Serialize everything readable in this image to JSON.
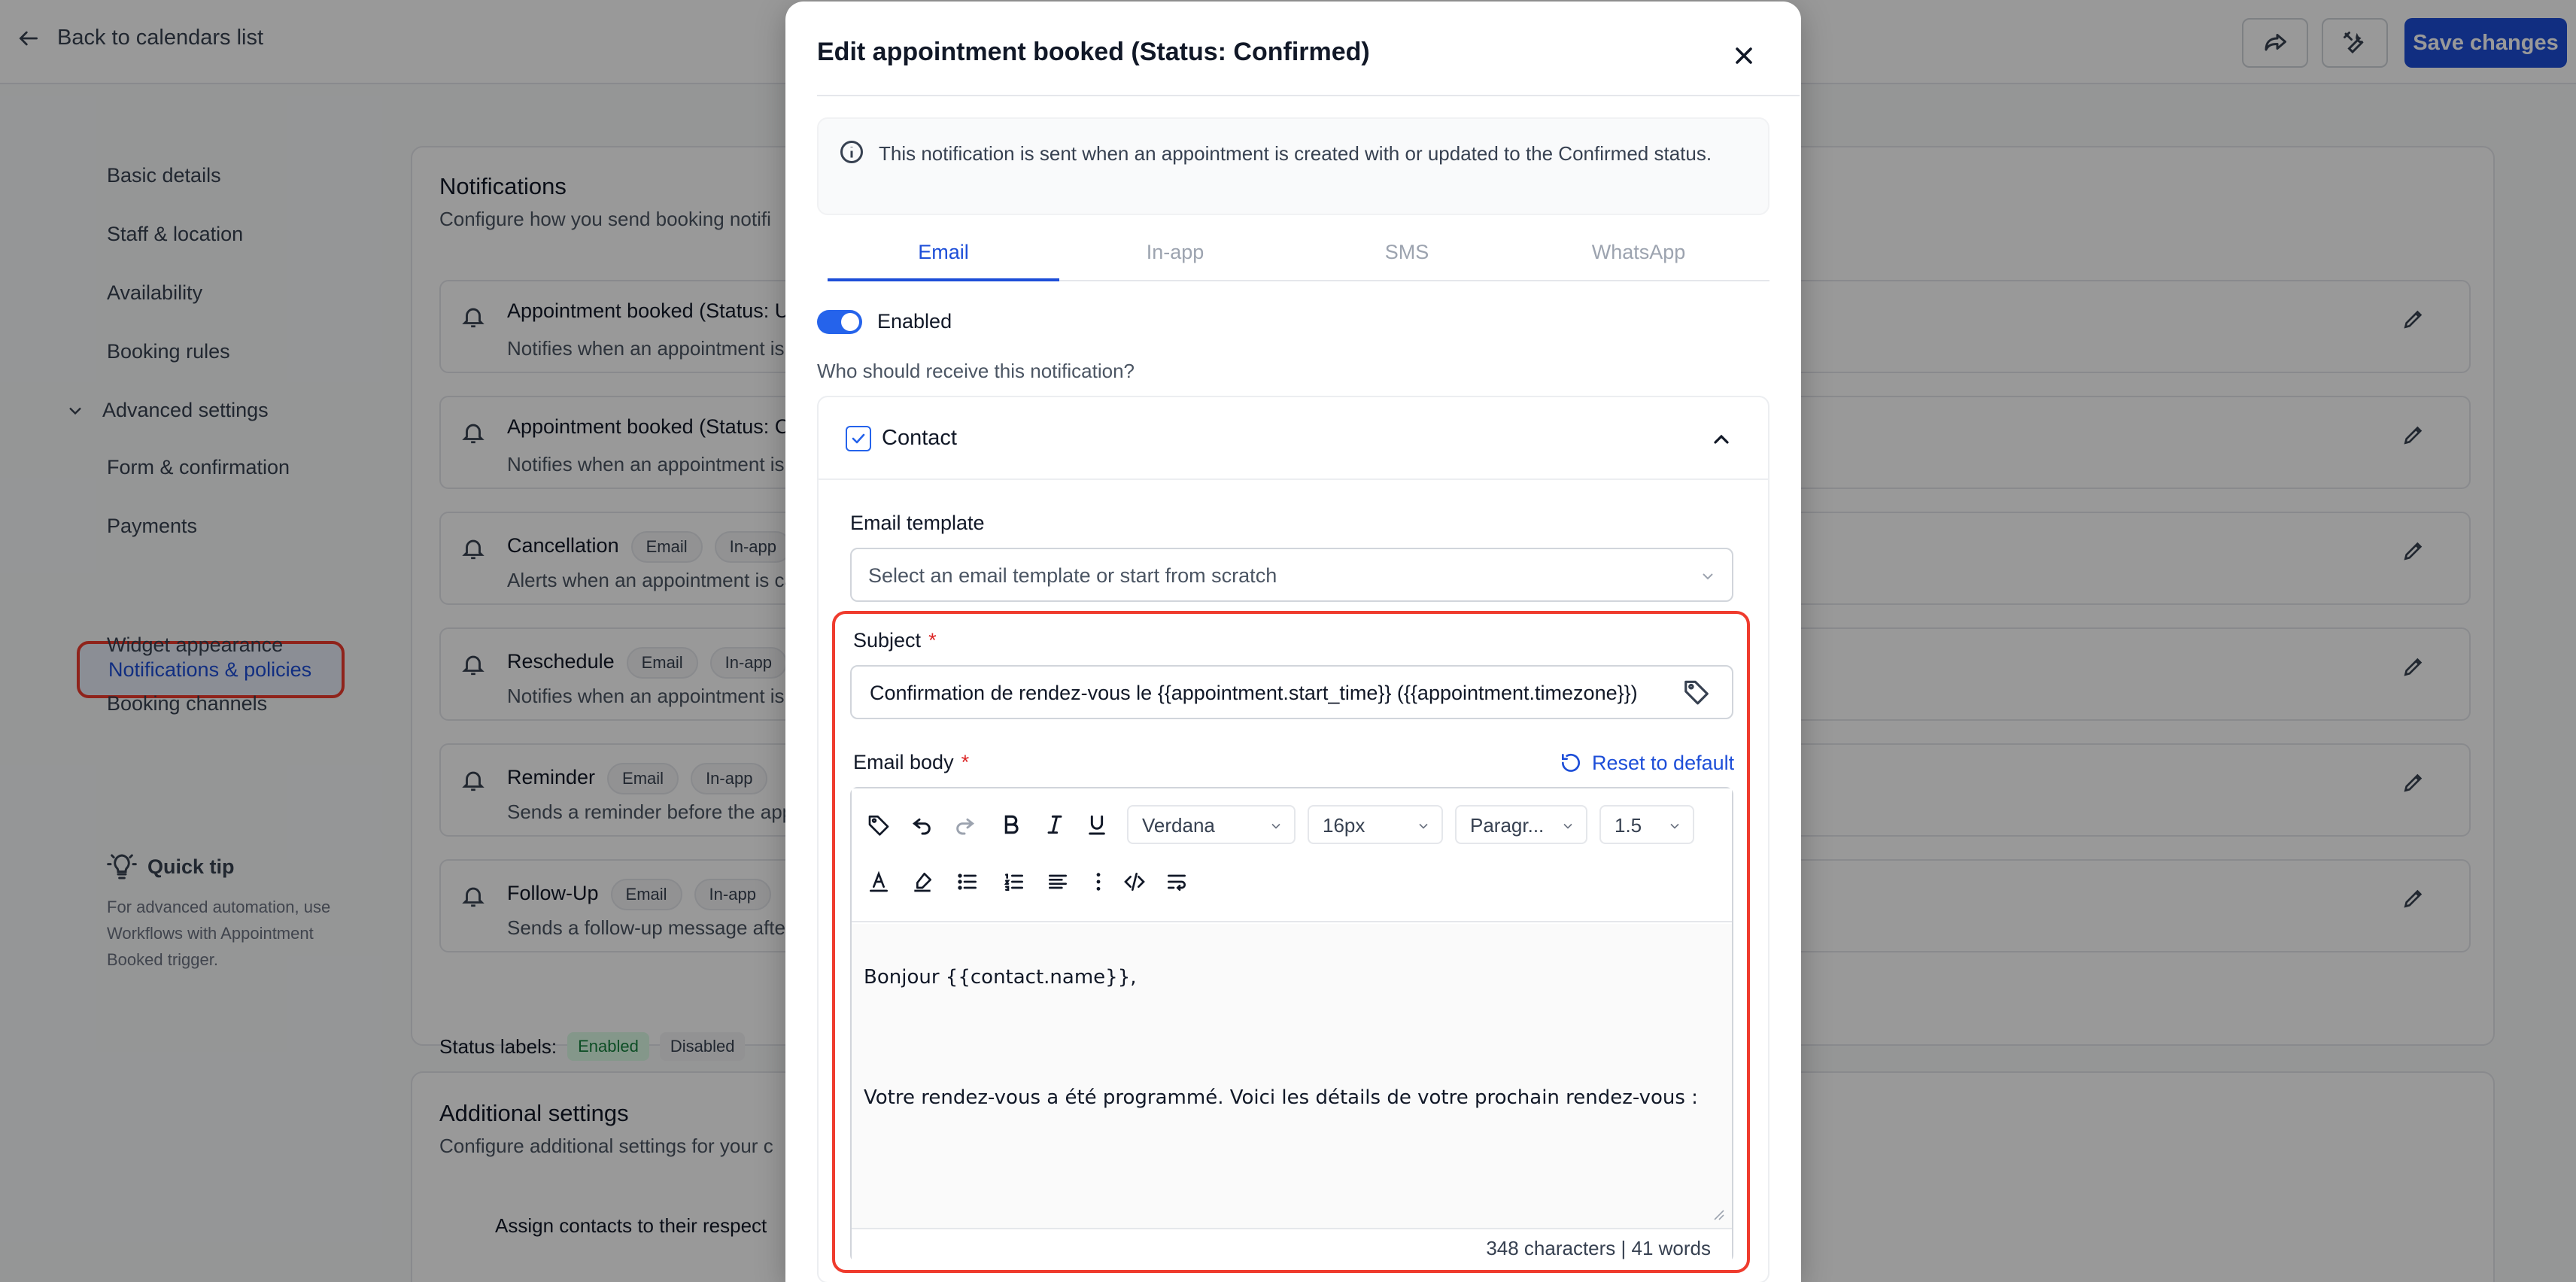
{
  "topbar": {
    "back_label": "Back to calendars list",
    "save_label": "Save changes"
  },
  "sidebar": {
    "items": [
      {
        "label": "Basic details"
      },
      {
        "label": "Staff & location"
      },
      {
        "label": "Availability"
      },
      {
        "label": "Booking rules"
      }
    ],
    "advanced_label": "Advanced settings",
    "advanced_items": [
      {
        "label": "Form & confirmation"
      },
      {
        "label": "Payments"
      },
      {
        "label": "Notifications & policies"
      },
      {
        "label": "Widget appearance"
      },
      {
        "label": "Booking channels"
      }
    ],
    "quick_tip_title": "Quick tip",
    "quick_tip_text": "For advanced automation, use Workflows with Appointment Booked trigger."
  },
  "notifications_card": {
    "title": "Notifications",
    "subtitle": "Configure how you send booking notifi",
    "rows": [
      {
        "title": "Appointment booked (Status: U",
        "desc": "Notifies when an appointment is b",
        "chips": []
      },
      {
        "title": "Appointment booked (Status: C",
        "desc": "Notifies when an appointment is s",
        "chips": []
      },
      {
        "title": "Cancellation",
        "desc": "Alerts when an appointment is ca",
        "chips": [
          "Email",
          "In-app"
        ]
      },
      {
        "title": "Reschedule",
        "desc": "Notifies when an appointment is r",
        "chips": [
          "Email",
          "In-app"
        ]
      },
      {
        "title": "Reminder",
        "desc": "Sends a reminder before the appo",
        "chips": [
          "Email",
          "In-app"
        ]
      },
      {
        "title": "Follow-Up",
        "desc": "Sends a follow-up message after",
        "chips": [
          "Email",
          "In-app"
        ]
      }
    ],
    "status_labels_label": "Status labels:",
    "status_enabled": "Enabled",
    "status_disabled": "Disabled"
  },
  "additional_card": {
    "title": "Additional settings",
    "subtitle": "Configure additional settings for your c",
    "cut_text": "Assign contacts to their respect"
  },
  "modal": {
    "title": "Edit appointment booked (Status: Confirmed)",
    "info_text": "This notification is sent when an appointment is created with or updated to the Confirmed status.",
    "tabs": [
      {
        "label": "Email"
      },
      {
        "label": "In-app"
      },
      {
        "label": "SMS"
      },
      {
        "label": "WhatsApp"
      }
    ],
    "enabled_label": "Enabled",
    "who_label": "Who should receive this notification?",
    "contact_label": "Contact",
    "template_label": "Email template",
    "template_placeholder": "Select an email template or start from scratch",
    "subject_label": "Subject",
    "required_mark": "*",
    "subject_value": "Confirmation de rendez-vous le {{appointment.start_time}} ({{appointment.timezone}})",
    "body_label": "Email body",
    "reset_label": "Reset to default",
    "font_family": "Verdana",
    "font_size": "16px",
    "block_format": "Paragr...",
    "line_height": "1.5",
    "body_lines": [
      "Bonjour {{contact.name}},",
      "Votre rendez-vous a été programmé. Voici les détails de votre prochain rendez-vous :"
    ],
    "counter": "348 characters | 41 words"
  }
}
